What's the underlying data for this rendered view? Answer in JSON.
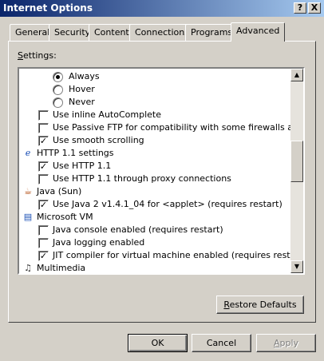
{
  "window": {
    "title": "Internet Options"
  },
  "titlebar": {
    "help_label": "?",
    "close_label": "X"
  },
  "tabs": [
    {
      "label": "General"
    },
    {
      "label": "Security"
    },
    {
      "label": "Content"
    },
    {
      "label": "Connections"
    },
    {
      "label": "Programs"
    },
    {
      "label": "Advanced",
      "selected": true
    }
  ],
  "settings": {
    "label_prefix": "S",
    "label_rest": "ettings:",
    "items": [
      {
        "type": "radio",
        "label": "Always",
        "checked": true
      },
      {
        "type": "radio",
        "label": "Hover",
        "checked": false
      },
      {
        "type": "radio",
        "label": "Never",
        "checked": false
      },
      {
        "type": "checkbox",
        "label": "Use inline AutoComplete",
        "checked": false
      },
      {
        "type": "checkbox",
        "label": "Use Passive FTP for compatibility with some firewalls and DSL m",
        "checked": false
      },
      {
        "type": "checkbox",
        "label": "Use smooth scrolling",
        "checked": true
      },
      {
        "type": "category",
        "label": "HTTP 1.1 settings",
        "icon": "ie-icon"
      },
      {
        "type": "checkbox",
        "label": "Use HTTP 1.1",
        "checked": true
      },
      {
        "type": "checkbox",
        "label": "Use HTTP 1.1 through proxy connections",
        "checked": false
      },
      {
        "type": "category",
        "label": "Java (Sun)",
        "icon": "java-icon"
      },
      {
        "type": "checkbox",
        "label": "Use Java 2 v1.4.1_04 for <applet> (requires restart)",
        "checked": true
      },
      {
        "type": "category",
        "label": "Microsoft VM",
        "icon": "ms-vm-icon"
      },
      {
        "type": "checkbox",
        "label": "Java console enabled (requires restart)",
        "checked": false
      },
      {
        "type": "checkbox",
        "label": "Java logging enabled",
        "checked": false
      },
      {
        "type": "checkbox",
        "label": "JIT compiler for virtual machine enabled (requires restart)",
        "checked": true
      },
      {
        "type": "category",
        "label": "Multimedia",
        "icon": "multimedia-icon"
      }
    ]
  },
  "buttons": {
    "restore_defaults_prefix": "R",
    "restore_defaults_rest": "estore Defaults",
    "ok": "OK",
    "cancel": "Cancel",
    "apply_prefix": "A",
    "apply_rest": "pply"
  },
  "scrollbar": {
    "up_glyph": "▲",
    "down_glyph": "▼"
  },
  "check_glyph": "✓"
}
